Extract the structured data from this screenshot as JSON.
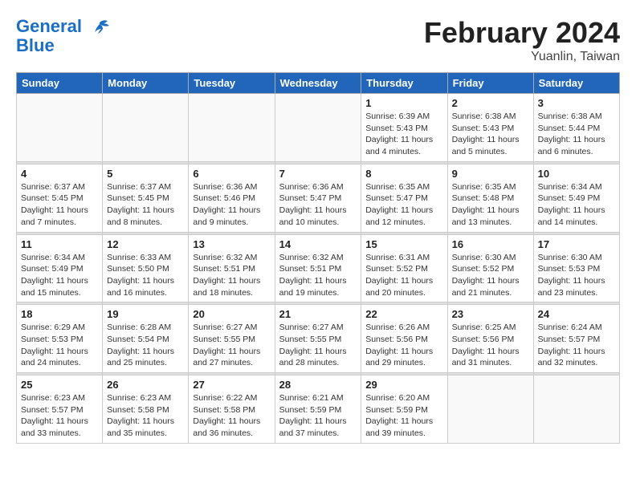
{
  "logo": {
    "line1": "General",
    "line2": "Blue"
  },
  "title": "February 2024",
  "location": "Yuanlin, Taiwan",
  "days_of_week": [
    "Sunday",
    "Monday",
    "Tuesday",
    "Wednesday",
    "Thursday",
    "Friday",
    "Saturday"
  ],
  "weeks": [
    [
      {
        "day": "",
        "info": ""
      },
      {
        "day": "",
        "info": ""
      },
      {
        "day": "",
        "info": ""
      },
      {
        "day": "",
        "info": ""
      },
      {
        "day": "1",
        "info": "Sunrise: 6:39 AM\nSunset: 5:43 PM\nDaylight: 11 hours\nand 4 minutes."
      },
      {
        "day": "2",
        "info": "Sunrise: 6:38 AM\nSunset: 5:43 PM\nDaylight: 11 hours\nand 5 minutes."
      },
      {
        "day": "3",
        "info": "Sunrise: 6:38 AM\nSunset: 5:44 PM\nDaylight: 11 hours\nand 6 minutes."
      }
    ],
    [
      {
        "day": "4",
        "info": "Sunrise: 6:37 AM\nSunset: 5:45 PM\nDaylight: 11 hours\nand 7 minutes."
      },
      {
        "day": "5",
        "info": "Sunrise: 6:37 AM\nSunset: 5:45 PM\nDaylight: 11 hours\nand 8 minutes."
      },
      {
        "day": "6",
        "info": "Sunrise: 6:36 AM\nSunset: 5:46 PM\nDaylight: 11 hours\nand 9 minutes."
      },
      {
        "day": "7",
        "info": "Sunrise: 6:36 AM\nSunset: 5:47 PM\nDaylight: 11 hours\nand 10 minutes."
      },
      {
        "day": "8",
        "info": "Sunrise: 6:35 AM\nSunset: 5:47 PM\nDaylight: 11 hours\nand 12 minutes."
      },
      {
        "day": "9",
        "info": "Sunrise: 6:35 AM\nSunset: 5:48 PM\nDaylight: 11 hours\nand 13 minutes."
      },
      {
        "day": "10",
        "info": "Sunrise: 6:34 AM\nSunset: 5:49 PM\nDaylight: 11 hours\nand 14 minutes."
      }
    ],
    [
      {
        "day": "11",
        "info": "Sunrise: 6:34 AM\nSunset: 5:49 PM\nDaylight: 11 hours\nand 15 minutes."
      },
      {
        "day": "12",
        "info": "Sunrise: 6:33 AM\nSunset: 5:50 PM\nDaylight: 11 hours\nand 16 minutes."
      },
      {
        "day": "13",
        "info": "Sunrise: 6:32 AM\nSunset: 5:51 PM\nDaylight: 11 hours\nand 18 minutes."
      },
      {
        "day": "14",
        "info": "Sunrise: 6:32 AM\nSunset: 5:51 PM\nDaylight: 11 hours\nand 19 minutes."
      },
      {
        "day": "15",
        "info": "Sunrise: 6:31 AM\nSunset: 5:52 PM\nDaylight: 11 hours\nand 20 minutes."
      },
      {
        "day": "16",
        "info": "Sunrise: 6:30 AM\nSunset: 5:52 PM\nDaylight: 11 hours\nand 21 minutes."
      },
      {
        "day": "17",
        "info": "Sunrise: 6:30 AM\nSunset: 5:53 PM\nDaylight: 11 hours\nand 23 minutes."
      }
    ],
    [
      {
        "day": "18",
        "info": "Sunrise: 6:29 AM\nSunset: 5:53 PM\nDaylight: 11 hours\nand 24 minutes."
      },
      {
        "day": "19",
        "info": "Sunrise: 6:28 AM\nSunset: 5:54 PM\nDaylight: 11 hours\nand 25 minutes."
      },
      {
        "day": "20",
        "info": "Sunrise: 6:27 AM\nSunset: 5:55 PM\nDaylight: 11 hours\nand 27 minutes."
      },
      {
        "day": "21",
        "info": "Sunrise: 6:27 AM\nSunset: 5:55 PM\nDaylight: 11 hours\nand 28 minutes."
      },
      {
        "day": "22",
        "info": "Sunrise: 6:26 AM\nSunset: 5:56 PM\nDaylight: 11 hours\nand 29 minutes."
      },
      {
        "day": "23",
        "info": "Sunrise: 6:25 AM\nSunset: 5:56 PM\nDaylight: 11 hours\nand 31 minutes."
      },
      {
        "day": "24",
        "info": "Sunrise: 6:24 AM\nSunset: 5:57 PM\nDaylight: 11 hours\nand 32 minutes."
      }
    ],
    [
      {
        "day": "25",
        "info": "Sunrise: 6:23 AM\nSunset: 5:57 PM\nDaylight: 11 hours\nand 33 minutes."
      },
      {
        "day": "26",
        "info": "Sunrise: 6:23 AM\nSunset: 5:58 PM\nDaylight: 11 hours\nand 35 minutes."
      },
      {
        "day": "27",
        "info": "Sunrise: 6:22 AM\nSunset: 5:58 PM\nDaylight: 11 hours\nand 36 minutes."
      },
      {
        "day": "28",
        "info": "Sunrise: 6:21 AM\nSunset: 5:59 PM\nDaylight: 11 hours\nand 37 minutes."
      },
      {
        "day": "29",
        "info": "Sunrise: 6:20 AM\nSunset: 5:59 PM\nDaylight: 11 hours\nand 39 minutes."
      },
      {
        "day": "",
        "info": ""
      },
      {
        "day": "",
        "info": ""
      }
    ]
  ]
}
